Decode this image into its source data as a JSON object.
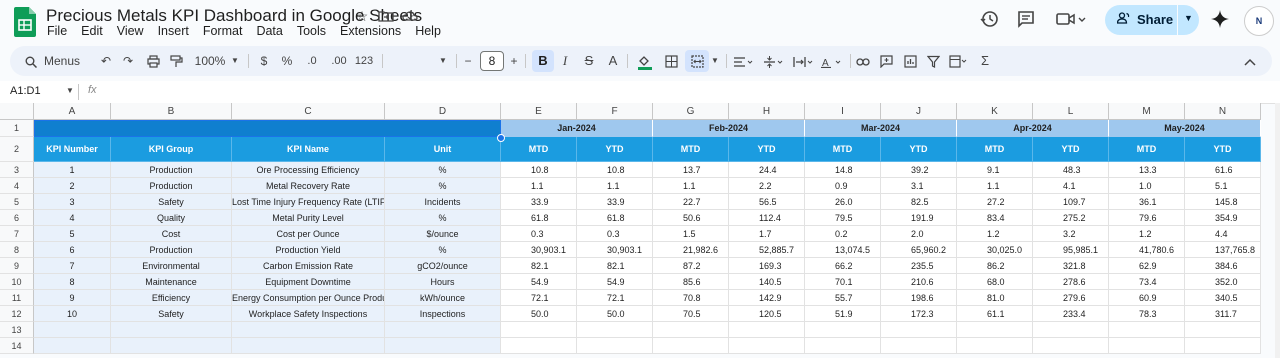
{
  "app": {
    "title": "Precious Metals KPI Dashboard in Google Sheets",
    "menu": [
      "File",
      "Edit",
      "View",
      "Insert",
      "Format",
      "Data",
      "Tools",
      "Extensions",
      "Help"
    ],
    "share_label": "Share",
    "avatar_text": "N"
  },
  "toolbar": {
    "search_label": "Menus",
    "zoom": "100%",
    "currency": "$",
    "percent": "%",
    "decimals_dec": ".0",
    "decimals_inc": ".00",
    "number_format": "123",
    "font_size": "8",
    "minus": "−",
    "plus": "+",
    "bold": "B",
    "italic": "I",
    "strike": "S",
    "text_color": "A"
  },
  "formula_bar": {
    "name_box": "A1:D1",
    "fx": "fx"
  },
  "columns": [
    "A",
    "B",
    "C",
    "D",
    "E",
    "F",
    "G",
    "H",
    "I",
    "J",
    "K",
    "L",
    "M",
    "N"
  ],
  "rows": [
    "1",
    "2",
    "3",
    "4",
    "5",
    "6",
    "7",
    "8",
    "9",
    "10",
    "11",
    "12",
    "13",
    "14"
  ],
  "months": [
    "Jan-2024",
    "Feb-2024",
    "Mar-2024",
    "Apr-2024",
    "May-2024"
  ],
  "header": {
    "kpi_number": "KPI Number",
    "kpi_group": "KPI Group",
    "kpi_name": "KPI Name",
    "unit": "Unit",
    "mtd": "MTD",
    "ytd": "YTD"
  },
  "table": [
    {
      "num": "1",
      "group": "Production",
      "name": "Ore Processing Efficiency",
      "unit": "%",
      "vals": [
        "10.8",
        "10.8",
        "13.7",
        "24.4",
        "14.8",
        "39.2",
        "9.1",
        "48.3",
        "13.3",
        "61.6"
      ]
    },
    {
      "num": "2",
      "group": "Production",
      "name": "Metal Recovery Rate",
      "unit": "%",
      "vals": [
        "1.1",
        "1.1",
        "1.1",
        "2.2",
        "0.9",
        "3.1",
        "1.1",
        "4.1",
        "1.0",
        "5.1"
      ]
    },
    {
      "num": "3",
      "group": "Safety",
      "name": "Lost Time Injury Frequency Rate (LTIFR)",
      "unit": "Incidents",
      "vals": [
        "33.9",
        "33.9",
        "22.7",
        "56.5",
        "26.0",
        "82.5",
        "27.2",
        "109.7",
        "36.1",
        "145.8"
      ]
    },
    {
      "num": "4",
      "group": "Quality",
      "name": "Metal Purity Level",
      "unit": "%",
      "vals": [
        "61.8",
        "61.8",
        "50.6",
        "112.4",
        "79.5",
        "191.9",
        "83.4",
        "275.2",
        "79.6",
        "354.9"
      ]
    },
    {
      "num": "5",
      "group": "Cost",
      "name": "Cost per Ounce",
      "unit": "$/ounce",
      "vals": [
        "0.3",
        "0.3",
        "1.5",
        "1.7",
        "0.2",
        "2.0",
        "1.2",
        "3.2",
        "1.2",
        "4.4"
      ]
    },
    {
      "num": "6",
      "group": "Production",
      "name": "Production Yield",
      "unit": "%",
      "vals": [
        "30,903.1",
        "30,903.1",
        "21,982.6",
        "52,885.7",
        "13,074.5",
        "65,960.2",
        "30,025.0",
        "95,985.1",
        "41,780.6",
        "137,765.8"
      ]
    },
    {
      "num": "7",
      "group": "Environmental",
      "name": "Carbon Emission Rate",
      "unit": "gCO2/ounce",
      "vals": [
        "82.1",
        "82.1",
        "87.2",
        "169.3",
        "66.2",
        "235.5",
        "86.2",
        "321.8",
        "62.9",
        "384.6"
      ]
    },
    {
      "num": "8",
      "group": "Maintenance",
      "name": "Equipment Downtime",
      "unit": "Hours",
      "vals": [
        "54.9",
        "54.9",
        "85.6",
        "140.5",
        "70.1",
        "210.6",
        "68.0",
        "278.6",
        "73.4",
        "352.0"
      ]
    },
    {
      "num": "9",
      "group": "Efficiency",
      "name": "Energy Consumption per Ounce Produced",
      "unit": "kWh/ounce",
      "vals": [
        "72.1",
        "72.1",
        "70.8",
        "142.9",
        "55.7",
        "198.6",
        "81.0",
        "279.6",
        "60.9",
        "340.5"
      ]
    },
    {
      "num": "10",
      "group": "Safety",
      "name": "Workplace Safety Inspections",
      "unit": "Inspections",
      "vals": [
        "50.0",
        "50.0",
        "70.5",
        "120.5",
        "51.9",
        "172.3",
        "61.1",
        "233.4",
        "78.3",
        "311.7"
      ]
    }
  ]
}
